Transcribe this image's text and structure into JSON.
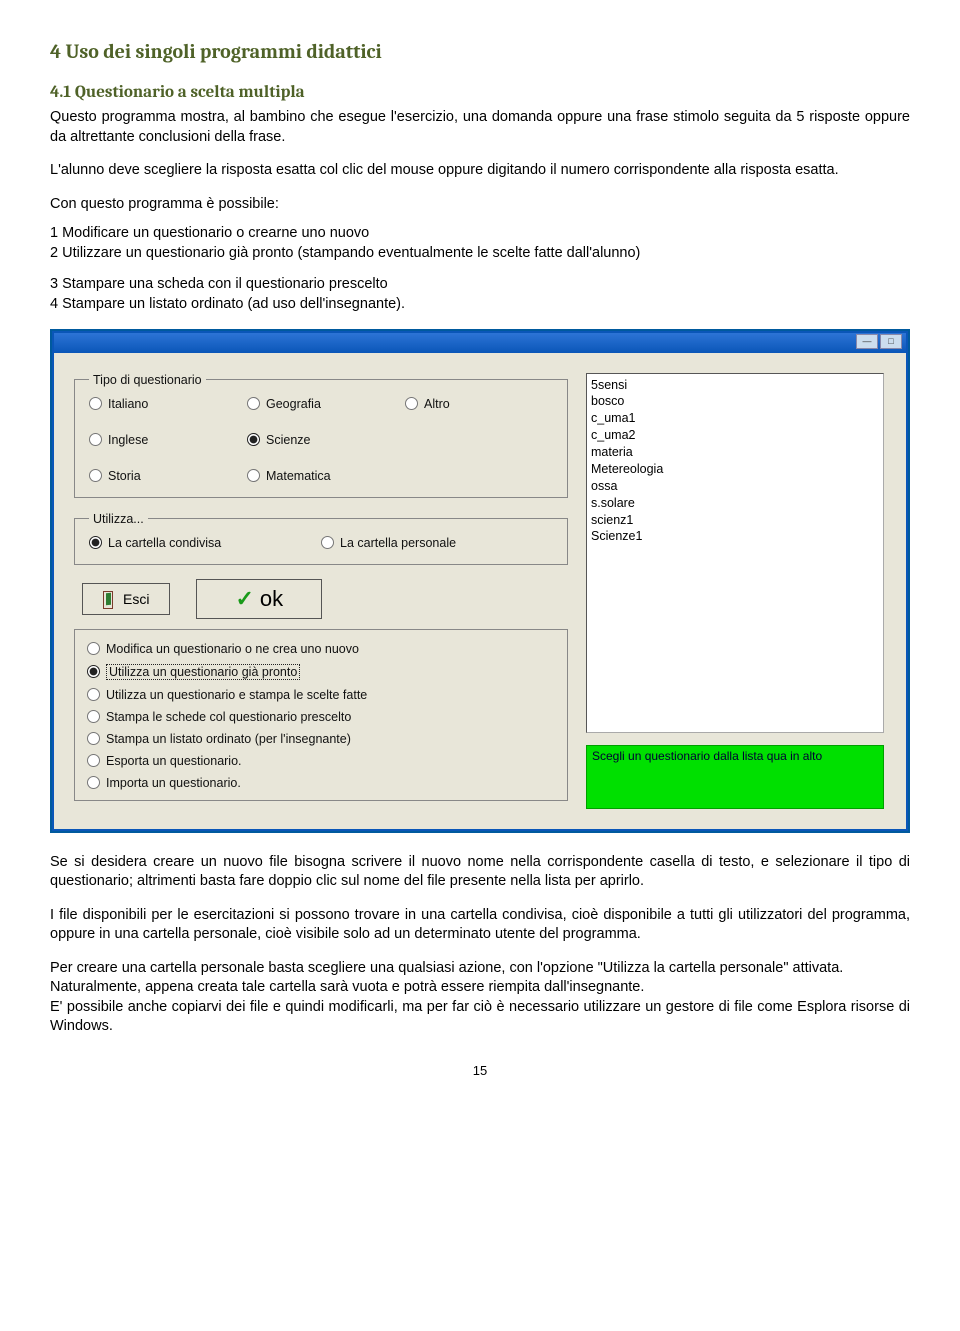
{
  "doc": {
    "h1": "4   Uso dei singoli programmi didattici",
    "h2": "4.1   Questionario a scelta multipla",
    "p1": "Questo programma mostra, al bambino che esegue l'esercizio, una domanda  oppure una frase stimolo seguita da 5 risposte oppure da altrettante conclusioni della frase.",
    "p2": "L'alunno deve scegliere la risposta esatta col clic del mouse oppure digitando il numero corrispondente alla risposta esatta.",
    "p_intro": "Con questo programma è possibile:",
    "li1": "1  Modificare un questionario o crearne uno nuovo",
    "li2": "2  Utilizzare un questionario già pronto  (stampando eventualmente le scelte fatte dall'alunno)",
    "li3": "3  Stampare una scheda con il questionario prescelto",
    "li4": "4  Stampare un listato ordinato (ad uso dell'insegnante).",
    "p3": "Se si desidera creare un nuovo file bisogna scrivere il nuovo nome nella corrispondente casella di testo, e selezionare il tipo di questionario;  altrimenti basta fare doppio clic sul nome del file presente nella lista per aprirlo.",
    "p4": "I file disponibili per le esercitazioni si possono trovare in una cartella condivisa, cioè disponibile a tutti gli utilizzatori del programma, oppure in una cartella personale, cioè visibile solo ad un determinato utente del programma.",
    "p5": "Per creare una cartella personale basta scegliere una qualsiasi azione, con l'opzione \"Utilizza la cartella personale\" attivata.",
    "p6": "Naturalmente, appena creata tale cartella sarà vuota e potrà essere riempita dall'insegnante.",
    "p7": "E' possibile anche copiarvi dei file e quindi modificarli, ma per far ciò è necessario utilizzare un gestore di file come Esplora risorse di Windows.",
    "pagenum": "15"
  },
  "app": {
    "group_tipo_legend": "Tipo di questionario",
    "tipo": {
      "italiano": "Italiano",
      "geografia": "Geografia",
      "altro": "Altro",
      "inglese": "Inglese",
      "scienze": "Scienze",
      "storia": "Storia",
      "matematica": "Matematica"
    },
    "group_utilizza_legend": "Utilizza...",
    "utilizza": {
      "condivisa": "La cartella condivisa",
      "personale": "La cartella personale"
    },
    "btn_esci": "Esci",
    "btn_ok": "ok",
    "actions": {
      "a1": "Modifica un questionario o ne crea uno nuovo",
      "a2": "Utilizza un questionario già pronto",
      "a3": "Utilizza un questionario e stampa le scelte fatte",
      "a4": "Stampa le schede col questionario prescelto",
      "a5": "Stampa un listato ordinato (per l'insegnante)",
      "a6": "Esporta un questionario.",
      "a7": "Importa un questionario."
    },
    "list_items": [
      "5sensi",
      "bosco",
      "c_uma1",
      "c_uma2",
      "materia",
      "Metereologia",
      "ossa",
      "s.solare",
      "scienz1",
      "Scienze1"
    ],
    "hint": "Scegli un questionario dalla lista qua in alto"
  }
}
